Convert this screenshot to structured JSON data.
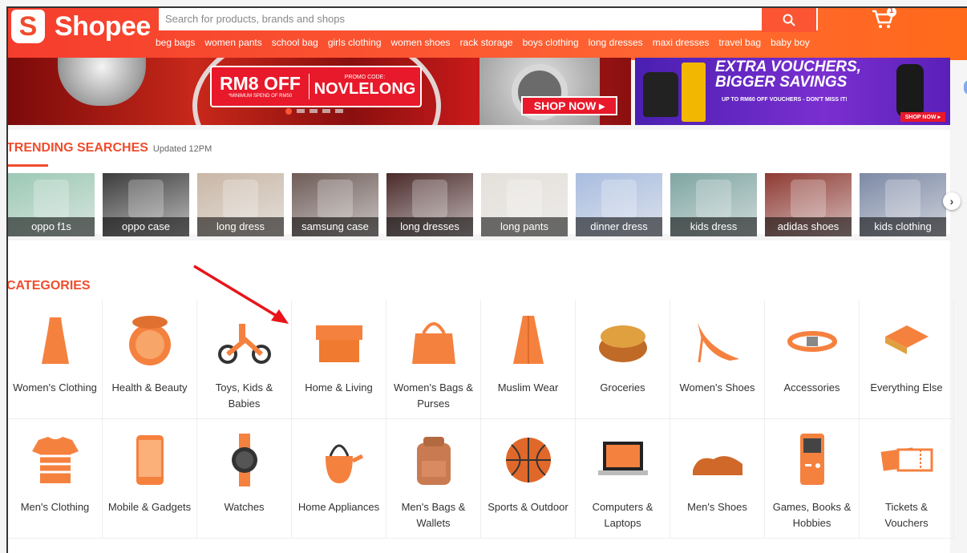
{
  "header": {
    "logo_text": "Shopee",
    "search_placeholder": "Search for products, brands and shops",
    "cart_count": "1",
    "suggestions": [
      "beg bags",
      "women pants",
      "school bag",
      "girls clothing",
      "women shoes",
      "rack storage",
      "boys clothing",
      "long dresses",
      "maxi dresses",
      "travel bag",
      "baby boy"
    ]
  },
  "banner_main": {
    "promo_amount": "RM8 OFF",
    "promo_min": "*MINIMUM SPEND OF RM50",
    "promo_code_label": "PROMO CODE:",
    "promo_code": "NOVLELONG",
    "cta": "SHOP NOW ▸"
  },
  "banner_side": {
    "title_line1": "EXTRA VOUCHERS,",
    "title_line2": "BIGGER SAVINGS",
    "subtitle": "UP TO RM60 OFF VOUCHERS - DON'T MISS IT!",
    "cta": "SHOP NOW ▸"
  },
  "trending": {
    "title": "TRENDING SEARCHES",
    "updated": "Updated 12PM",
    "items": [
      {
        "label": "oppo f1s",
        "color": "#9cc9b5"
      },
      {
        "label": "oppo case",
        "color": "#3c3c3c"
      },
      {
        "label": "long dress",
        "color": "#c9b7a6"
      },
      {
        "label": "samsung case",
        "color": "#6e5c57"
      },
      {
        "label": "long dresses",
        "color": "#4b2a2a"
      },
      {
        "label": "long pants",
        "color": "#e4e0da"
      },
      {
        "label": "dinner dress",
        "color": "#a9bde0"
      },
      {
        "label": "kids dress",
        "color": "#7fa6a2"
      },
      {
        "label": "adidas shoes",
        "color": "#8f3a33"
      },
      {
        "label": "kids clothing",
        "color": "#7d8aa6"
      }
    ]
  },
  "categories": {
    "title": "CATEGORIES",
    "items": [
      {
        "label": "Women's Clothing",
        "icon": "dress-icon"
      },
      {
        "label": "Health & Beauty",
        "icon": "compact-powder-icon"
      },
      {
        "label": "Toys, Kids & Babies",
        "icon": "tricycle-icon"
      },
      {
        "label": "Home & Living",
        "icon": "storage-box-icon"
      },
      {
        "label": "Women's Bags & Purses",
        "icon": "handbag-icon"
      },
      {
        "label": "Muslim Wear",
        "icon": "cape-icon"
      },
      {
        "label": "Groceries",
        "icon": "snack-bowl-icon"
      },
      {
        "label": "Women's Shoes",
        "icon": "high-heels-icon"
      },
      {
        "label": "Accessories",
        "icon": "bracelet-icon"
      },
      {
        "label": "Everything Else",
        "icon": "cushion-icon"
      },
      {
        "label": "Men's Clothing",
        "icon": "tshirt-icon"
      },
      {
        "label": "Mobile & Gadgets",
        "icon": "phone-icon"
      },
      {
        "label": "Watches",
        "icon": "watch-icon"
      },
      {
        "label": "Home Appliances",
        "icon": "kettle-icon"
      },
      {
        "label": "Men's Bags & Wallets",
        "icon": "backpack-icon"
      },
      {
        "label": "Sports & Outdoor",
        "icon": "basketball-icon"
      },
      {
        "label": "Computers & Laptops",
        "icon": "laptop-icon"
      },
      {
        "label": "Men's Shoes",
        "icon": "men-shoes-icon"
      },
      {
        "label": "Games, Books & Hobbies",
        "icon": "game-console-icon"
      },
      {
        "label": "Tickets & Vouchers",
        "icon": "ticket-icon"
      }
    ]
  },
  "colors": {
    "brand": "#ee4d2d",
    "icon_orange": "#f5813f"
  }
}
